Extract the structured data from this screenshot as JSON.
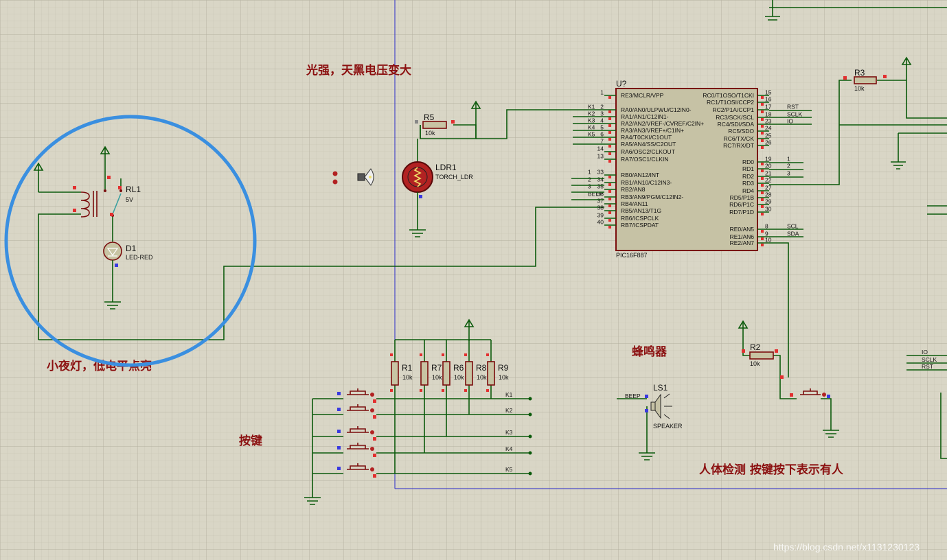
{
  "notes": {
    "light": "光强，天黑电压变大",
    "nightlight": "小夜灯，低电平点亮",
    "keys": "按键",
    "buzzer": "蜂鸣器",
    "human": "人体检测 按键按下表示有人"
  },
  "mcu": {
    "ref": "U?",
    "part": "PIC16F887",
    "left_pins": [
      {
        "num": "1",
        "name": "RE3/MCLR/VPP",
        "net": ""
      },
      {
        "num": "2",
        "name": "RA0/AN0/ULPWU/C12IN0-",
        "net": "K1"
      },
      {
        "num": "3",
        "name": "RA1/AN1/C12IN1-",
        "net": "K2"
      },
      {
        "num": "4",
        "name": "RA2/AN2/VREF-/CVREF/C2IN+",
        "net": "K3"
      },
      {
        "num": "5",
        "name": "RA3/AN3/VREF+/C1IN+",
        "net": "K4"
      },
      {
        "num": "6",
        "name": "RA4/T0CKI/C1OUT",
        "net": "K5"
      },
      {
        "num": "7",
        "name": "RA5/AN4/SS/C2OUT",
        "net": ""
      },
      {
        "num": "14",
        "name": "RA6/OSC2/CLKOUT",
        "net": ""
      },
      {
        "num": "13",
        "name": "RA7/OSC1/CLKIN",
        "net": ""
      },
      {
        "num": "33",
        "name": "RB0/AN12/INT",
        "net": "1"
      },
      {
        "num": "34",
        "name": "RB1/AN10/C12IN3-",
        "net": "2"
      },
      {
        "num": "35",
        "name": "RB2/AN8",
        "net": "3"
      },
      {
        "num": "36",
        "name": "RB3/AN9/PGM/C12IN2-",
        "net": "BEEP"
      },
      {
        "num": "37",
        "name": "RB4/AN11",
        "net": ""
      },
      {
        "num": "38",
        "name": "RB5/AN13/T1G",
        "net": ""
      },
      {
        "num": "39",
        "name": "RB6/ICSPCLK",
        "net": ""
      },
      {
        "num": "40",
        "name": "RB7/ICSPDAT",
        "net": ""
      }
    ],
    "right_pins": [
      {
        "num": "15",
        "name": "RC0/T1OSO/T1CKI",
        "net": ""
      },
      {
        "num": "16",
        "name": "RC1/T1OSI/CCP2",
        "net": ""
      },
      {
        "num": "17",
        "name": "RC2/P1A/CCP1",
        "net": "RST"
      },
      {
        "num": "18",
        "name": "RC3/SCK/SCL",
        "net": "SCLK"
      },
      {
        "num": "23",
        "name": "RC4/SDI/SDA",
        "net": "IO"
      },
      {
        "num": "24",
        "name": "RC5/SDO",
        "net": ""
      },
      {
        "num": "25",
        "name": "RC6/TX/CK",
        "net": ""
      },
      {
        "num": "26",
        "name": "RC7/RX/DT",
        "net": ""
      },
      {
        "num": "19",
        "name": "RD0",
        "net": "1"
      },
      {
        "num": "20",
        "name": "RD1",
        "net": "2"
      },
      {
        "num": "21",
        "name": "RD2",
        "net": "3"
      },
      {
        "num": "22",
        "name": "RD3",
        "net": ""
      },
      {
        "num": "27",
        "name": "RD4",
        "net": ""
      },
      {
        "num": "28",
        "name": "RD5/P1B",
        "net": ""
      },
      {
        "num": "29",
        "name": "RD6/P1C",
        "net": ""
      },
      {
        "num": "30",
        "name": "RD7/P1D",
        "net": ""
      },
      {
        "num": "8",
        "name": "RE0/AN5",
        "net": "SCL"
      },
      {
        "num": "9",
        "name": "RE1/AN6",
        "net": "SDA"
      },
      {
        "num": "10",
        "name": "RE2/AN7",
        "net": ""
      }
    ]
  },
  "components": {
    "rl1": {
      "ref": "RL1",
      "value": "5V"
    },
    "d1": {
      "ref": "D1",
      "value": "LED-RED"
    },
    "r5": {
      "ref": "R5",
      "value": "10k"
    },
    "ldr1": {
      "ref": "LDR1",
      "value": "TORCH_LDR"
    },
    "r3": {
      "ref": "R3",
      "value": "10k"
    },
    "r2": {
      "ref": "R2",
      "value": "10k"
    },
    "ls1": {
      "ref": "LS1",
      "value": "SPEAKER"
    },
    "resistors": [
      {
        "ref": "R1",
        "value": "10k"
      },
      {
        "ref": "R7",
        "value": "10k"
      },
      {
        "ref": "R6",
        "value": "10k"
      },
      {
        "ref": "R8",
        "value": "10k"
      },
      {
        "ref": "R9",
        "value": "10k"
      }
    ]
  },
  "nets": {
    "keys": [
      "K1",
      "K2",
      "K3",
      "K4",
      "K5"
    ],
    "beep": "BEEP",
    "right_edge": [
      "IO",
      "SCLK",
      "RST"
    ]
  },
  "watermark": "https://blog.csdn.net/x1131230123",
  "colors": {
    "background": "#d9d6c6",
    "wire": "#0b5a0b",
    "component": "#7a0c0c",
    "highlight_circle": "#3a8fe0",
    "note_text": "#8b1010"
  }
}
